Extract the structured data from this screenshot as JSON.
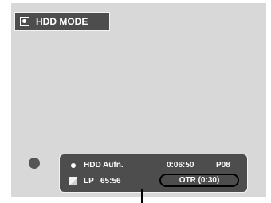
{
  "header": {
    "mode_label": "HDD MODE"
  },
  "info": {
    "rec_label": "HDD Aufn.",
    "rec_time": "0:06:50",
    "program": "P08",
    "quality": "LP",
    "remaining": "65:56",
    "otr": "OTR (0:30)"
  },
  "icons": {
    "mode": "hdd-icon",
    "record": "record-dot-icon",
    "quality": "tape-icon"
  },
  "colors": {
    "screen_bg": "#d8d8d8",
    "panel_bg": "#4d4d4d",
    "text": "#ffffff"
  }
}
